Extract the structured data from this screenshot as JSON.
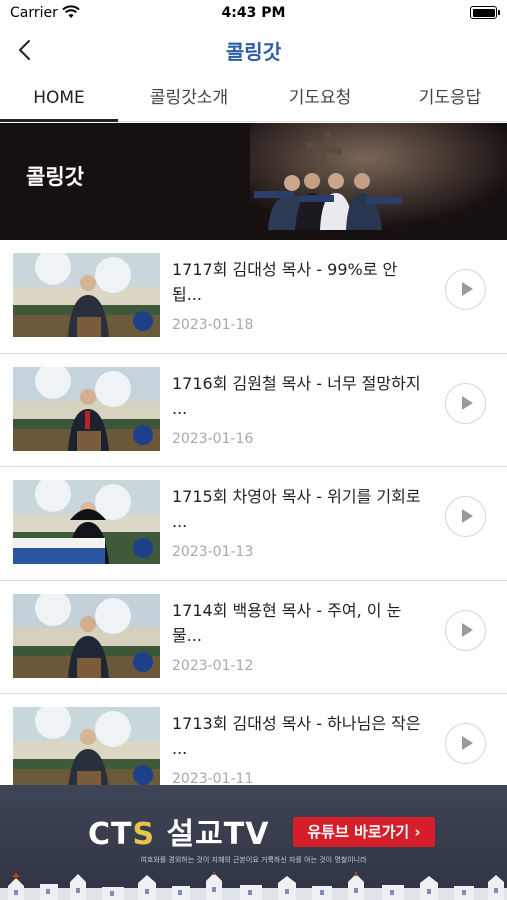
{
  "status": {
    "carrier": "Carrier",
    "time": "4:43 PM"
  },
  "nav": {
    "title": "콜링갓"
  },
  "tabs": [
    {
      "label": "HOME",
      "active": true
    },
    {
      "label": "콜링갓소개",
      "active": false
    },
    {
      "label": "기도요청",
      "active": false
    },
    {
      "label": "기도응답",
      "active": false
    }
  ],
  "banner": {
    "title": "콜링갓"
  },
  "videos": [
    {
      "title": "1717회 김대성 목사 - 99%로 안 됩...",
      "date": "2023-01-18"
    },
    {
      "title": "1716회 김원철 목사 - 너무 절망하지 ...",
      "date": "2023-01-16"
    },
    {
      "title": "1715회 차영아 목사 - 위기를 기회로 ...",
      "date": "2023-01-13"
    },
    {
      "title": "1714회 백용현 목사 - 주여, 이 눈물...",
      "date": "2023-01-12"
    },
    {
      "title": "1713회 김대성 목사 - 하나님은 작은 ...",
      "date": "2023-01-11"
    }
  ],
  "ad": {
    "logo_prefix": "CT",
    "logo_s": "S",
    "logo_suffix": " 설교TV",
    "button_label": "유튜브 바로가기 ›",
    "tagline": "여호와를 경외하는 것이 지혜의 근본이요 거룩하신 자를 아는 것이 명철이니라"
  },
  "colors": {
    "title_blue": "#2b5ea7",
    "banner_bg": "#171010",
    "ad_bg": "#353a4a",
    "ad_button": "#d61e2a"
  }
}
